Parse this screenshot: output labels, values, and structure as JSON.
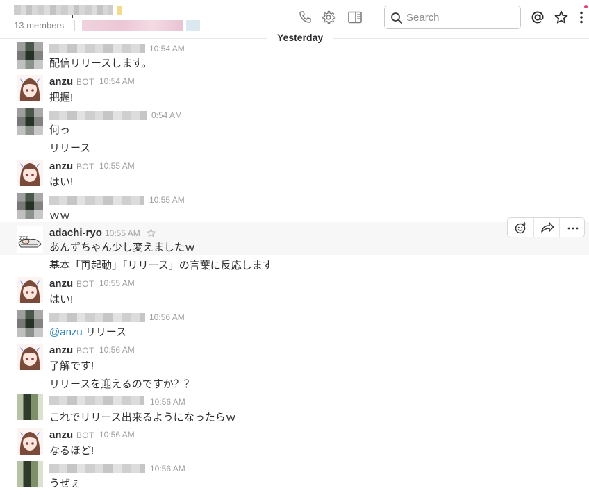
{
  "header": {
    "member_count": "13 members",
    "search_placeholder": "Search"
  },
  "day_divider": "Yesterday",
  "messages": [
    {
      "time": "10:54 AM",
      "lines": [
        "配信リリースします。"
      ]
    },
    {
      "sender": "anzu",
      "badge": "BOT",
      "time": "10:54 AM",
      "lines": [
        "把握!"
      ]
    },
    {
      "time": "0:54 AM",
      "lines": [
        "何っ",
        "リリース"
      ]
    },
    {
      "sender": "anzu",
      "badge": "BOT",
      "time": "10:55 AM",
      "lines": [
        "はい!"
      ]
    },
    {
      "time": "10:55 AM",
      "lines": [
        "ｗｗ"
      ]
    },
    {
      "sender": "adachi-ryo",
      "time": "10:55 AM",
      "lines": [
        "あんずちゃん少し変えましたｗ",
        "基本「再起動」「リリース」の言葉に反応します"
      ]
    },
    {
      "sender": "anzu",
      "badge": "BOT",
      "time": "10:55 AM",
      "lines": [
        "はい!"
      ]
    },
    {
      "time": "10:56 AM",
      "mention": "@anzu",
      "lines": [
        " リリース"
      ]
    },
    {
      "sender": "anzu",
      "badge": "BOT",
      "time": "10:56 AM",
      "lines": [
        "了解です!",
        "リリースを迎えるのですか？？"
      ]
    },
    {
      "time": "10:56 AM",
      "lines": [
        "これでリリース出来るようになったらｗ"
      ]
    },
    {
      "sender": "anzu",
      "badge": "BOT",
      "time": "10:56 AM",
      "lines": [
        "なるほど!"
      ]
    },
    {
      "time": "10:56 AM",
      "lines": [
        "うぜぇ"
      ]
    }
  ],
  "colors": {
    "mention": "#2a80b9",
    "hover_row": "#f7f7f7",
    "notification": "#e0406a"
  },
  "icons": [
    "phone-icon",
    "gear-icon",
    "sidebar-toggle-icon",
    "search-icon",
    "at-sign-icon",
    "star-icon",
    "more-vertical-icon",
    "add-reaction-icon",
    "share-icon",
    "more-horizontal-icon"
  ]
}
